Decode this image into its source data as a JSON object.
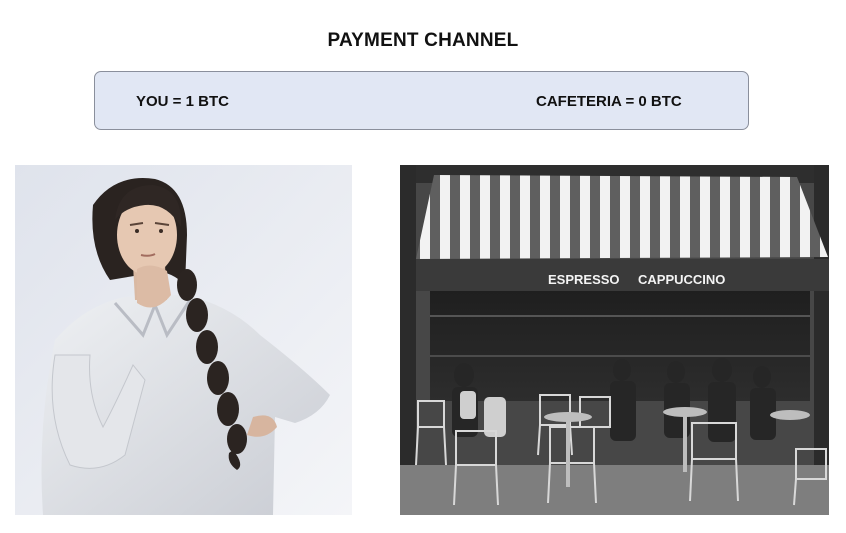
{
  "title": "PAYMENT CHANNEL",
  "channel": {
    "you_balance": "YOU = 1 BTC",
    "cafeteria_balance": "CAFETERIA = 0 BTC"
  },
  "cafe_photo": {
    "awning_text_left": "ESPRESSO",
    "awning_text_right": "CAPPUCCINO"
  },
  "colors": {
    "box_fill": "#e1e7f4",
    "box_border": "#8a8f9c"
  }
}
